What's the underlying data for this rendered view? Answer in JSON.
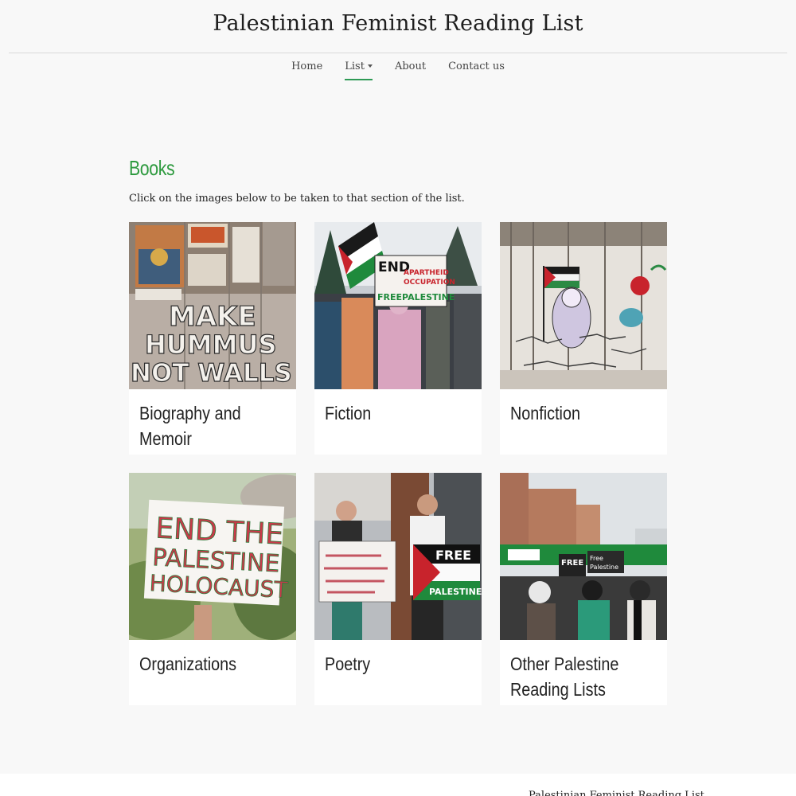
{
  "site": {
    "title": "Palestinian Feminist Reading List"
  },
  "nav": {
    "items": [
      {
        "label": "Home"
      },
      {
        "label": "List",
        "has_dropdown": true,
        "active": true
      },
      {
        "label": "About"
      },
      {
        "label": "Contact us"
      }
    ]
  },
  "main": {
    "heading": "Books",
    "intro": "Click on the images below to be taken to that section of the list.",
    "cards": [
      {
        "label": "Biography and Memoir",
        "image_text": [
          "MAKE",
          "HUMMUS",
          "NOT WALLS"
        ]
      },
      {
        "label": "Fiction",
        "image_text": [
          "END",
          "APARTHEID",
          "OCCUPATION",
          "FREEPALESTINE"
        ]
      },
      {
        "label": "Nonfiction"
      },
      {
        "label": "Organizations",
        "image_text": [
          "END THE",
          "PALESTINE",
          "HOLOCAUST"
        ]
      },
      {
        "label": "Poetry",
        "image_text": [
          "FREE",
          "PALESTINE"
        ]
      },
      {
        "label": "Other Palestine Reading Lists",
        "image_text": [
          "FREE",
          "Free",
          "Palestine"
        ]
      }
    ]
  },
  "footer": {
    "text": "Palestinian Feminist Reading List"
  },
  "colors": {
    "accent": "#2e9a3f",
    "background": "#f8f8f8",
    "card": "#ffffff"
  }
}
